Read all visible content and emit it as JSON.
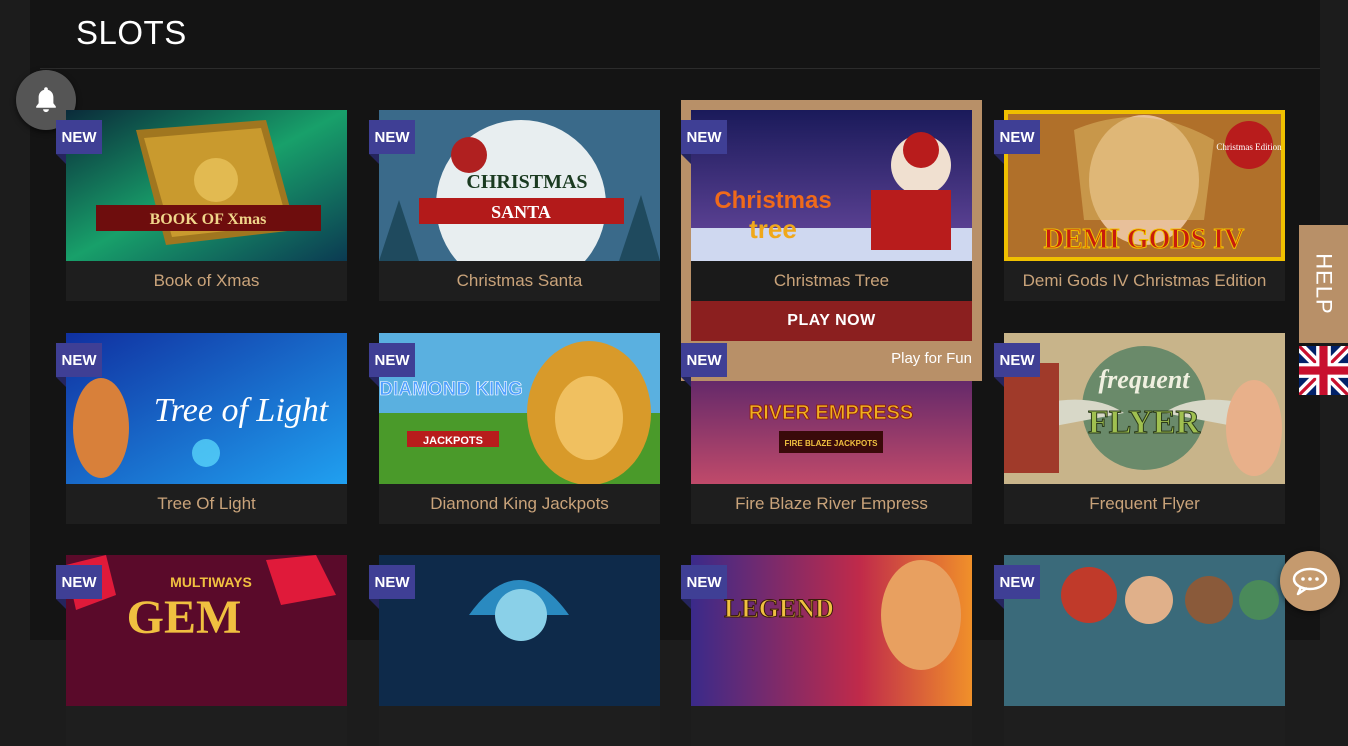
{
  "page": {
    "title": "SLOTS",
    "badge_label": "NEW"
  },
  "hover": {
    "play_now": "PLAY NOW",
    "play_for_fun": "Play for Fun"
  },
  "help": {
    "label": "HELP"
  },
  "language": {
    "flag": "uk-flag-icon"
  },
  "icons": {
    "notifications": "bell-icon",
    "chat": "chat-bubble-icon"
  },
  "colors": {
    "badge": "#3f3f95",
    "game_name": "#c9a37a",
    "play_now": "#8b1f1f",
    "accent": "#b89068"
  },
  "games": [
    {
      "name": "Book of Xmas",
      "thumb_art": "BOOK OF Xmas"
    },
    {
      "name": "Christmas Santa",
      "thumb_art_top": "CHRISTMAS",
      "thumb_art": "SANTA"
    },
    {
      "name": "Christmas Tree",
      "thumb_art_top": "Christmas",
      "thumb_art": "tree"
    },
    {
      "name": "Demi Gods IV Christmas Edition",
      "thumb_art": "DEMI GODS IV",
      "thumb_art_top": "Christmas Edition"
    },
    {
      "name": "Tree Of Light",
      "thumb_art": "Tree of Light"
    },
    {
      "name": "Diamond King Jackpots",
      "thumb_art_top": "DIAMOND KING",
      "thumb_art": "JACKPOTS"
    },
    {
      "name": "Fire Blaze River Empress",
      "thumb_art": "RIVER EMPRESS",
      "thumb_art_top": "FIRE BLAZE JACKPOTS"
    },
    {
      "name": "Frequent Flyer",
      "thumb_art_top": "frequent",
      "thumb_art": "FLYER"
    },
    {
      "name": "",
      "thumb_art_top": "MULTIWAYS",
      "thumb_art": "GEM"
    },
    {
      "name": "",
      "thumb_art": ""
    },
    {
      "name": "",
      "thumb_art": "LEGEND"
    },
    {
      "name": "",
      "thumb_art": ""
    }
  ]
}
